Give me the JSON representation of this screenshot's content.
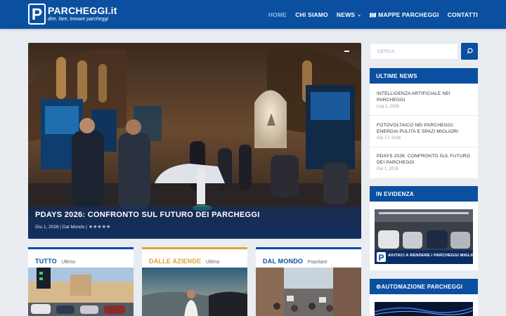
{
  "brand": {
    "name": "PARCHEGGI.it",
    "tagline": "dire, fare, trovare parcheggi",
    "logo_letter": "P"
  },
  "nav": [
    {
      "label": "HOME",
      "active": true
    },
    {
      "label": "CHI SIAMO"
    },
    {
      "label": "NEWS",
      "has_dropdown": true
    },
    {
      "label": "MAPPE PARCHEGGI",
      "icon": "map-icon"
    },
    {
      "label": "CONTATTI"
    }
  ],
  "hero": {
    "title": "PDAYS 2026: CONFRONTO SUL FUTURO DEI PARCHEGGI",
    "meta": "Giu 1, 2026 | Dal Mondo |",
    "rating": 0,
    "stars": 5
  },
  "cards": [
    {
      "title": "TUTTO",
      "subtitle": "Ultimo",
      "accent": "#0b4fa0",
      "title_color": "#0b4fa0"
    },
    {
      "title": "DALLE AZIENDE",
      "subtitle": "Ultimo",
      "accent": "#e0a03a",
      "title_color": "#e0a03a"
    },
    {
      "title": "DAL MONDO",
      "subtitle": "Popolare",
      "accent": "#0b4fa0",
      "title_color": "#0b4fa0"
    }
  ],
  "search": {
    "placeholder": "CERCA"
  },
  "latest_news": {
    "heading": "ULTIME NEWS",
    "items": [
      {
        "title": "INTELLIGENZA ARTIFICIALE NEI PARCHEGGI",
        "date": "Lug 1, 2026"
      },
      {
        "title": "FOTOVOLTAICO NEI PARCHEGGI: ENERGIA PULITA E SPAZI MIGLIORI",
        "date": "Giu 17, 2026"
      },
      {
        "title": "PDAYS 2026: CONFRONTO SUL FUTURO DEI PARCHEGGI",
        "date": "Giu 1, 2026"
      }
    ]
  },
  "featured": {
    "heading": "IN EVIDENZA",
    "banner_text": "AIUTACI A RENDERE I PARCHEGGI MIGLIORI"
  },
  "automation": {
    "heading": "AUTOMAZIONE PARCHEGGI",
    "icon": "gear-icon"
  },
  "colors": {
    "brand_blue": "#0b4fa0",
    "page_bg": "#e9ecf1",
    "orange_accent": "#e0a03a"
  }
}
